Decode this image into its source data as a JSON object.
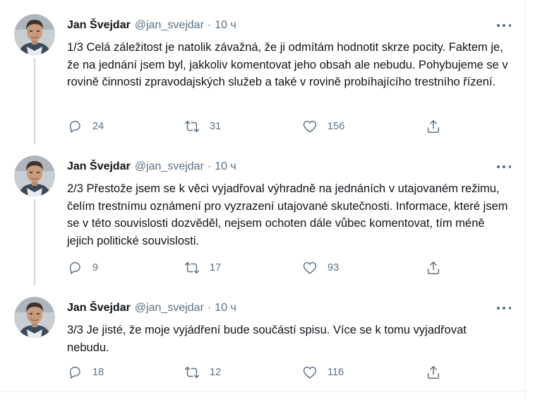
{
  "colors": {
    "text": "#0f1419",
    "secondary": "#5b7083",
    "thread_line": "#cfd9de",
    "divider": "#e6ecf0"
  },
  "tweets": [
    {
      "author": "Jan Švejdar",
      "handle": "@jan_svejdar",
      "separator": "·",
      "time": "10 ч",
      "text": "1/3 Celá záležitost je natolik závažná, že ji odmítám hodnotit skrze pocity. Faktem je, že na jednání jsem byl, jakkoliv komentovat jeho obsah ale nebudu. Pohybujeme se v rovině činnosti zpravodajských služeb a také v rovině probíhajícího trestního řízení.",
      "replies": "24",
      "retweets": "31",
      "likes": "156",
      "icons": {
        "reply": "reply-icon",
        "retweet": "retweet-icon",
        "like": "heart-icon",
        "share": "share-icon",
        "more": "more-icon"
      }
    },
    {
      "author": "Jan Švejdar",
      "handle": "@jan_svejdar",
      "separator": "·",
      "time": "10 ч",
      "text": "2/3 Přestože jsem se k věci vyjadřoval výhradně na jednáních v utajovaném režimu, čelím trestnímu oznámení pro vyzrazení utajované skutečnosti. Informace, které jsem se v této souvislosti dozvěděl, nejsem ochoten dále vůbec komentovat, tím méně jejich politické souvislosti.",
      "replies": "9",
      "retweets": "17",
      "likes": "93",
      "icons": {
        "reply": "reply-icon",
        "retweet": "retweet-icon",
        "like": "heart-icon",
        "share": "share-icon",
        "more": "more-icon"
      }
    },
    {
      "author": "Jan Švejdar",
      "handle": "@jan_svejdar",
      "separator": "·",
      "time": "10 ч",
      "text": "3/3 Je jisté, že moje vyjádření bude součástí spisu. Více se k tomu vyjadřovat nebudu.",
      "replies": "18",
      "retweets": "12",
      "likes": "116",
      "icons": {
        "reply": "reply-icon",
        "retweet": "retweet-icon",
        "like": "heart-icon",
        "share": "share-icon",
        "more": "more-icon"
      }
    }
  ]
}
